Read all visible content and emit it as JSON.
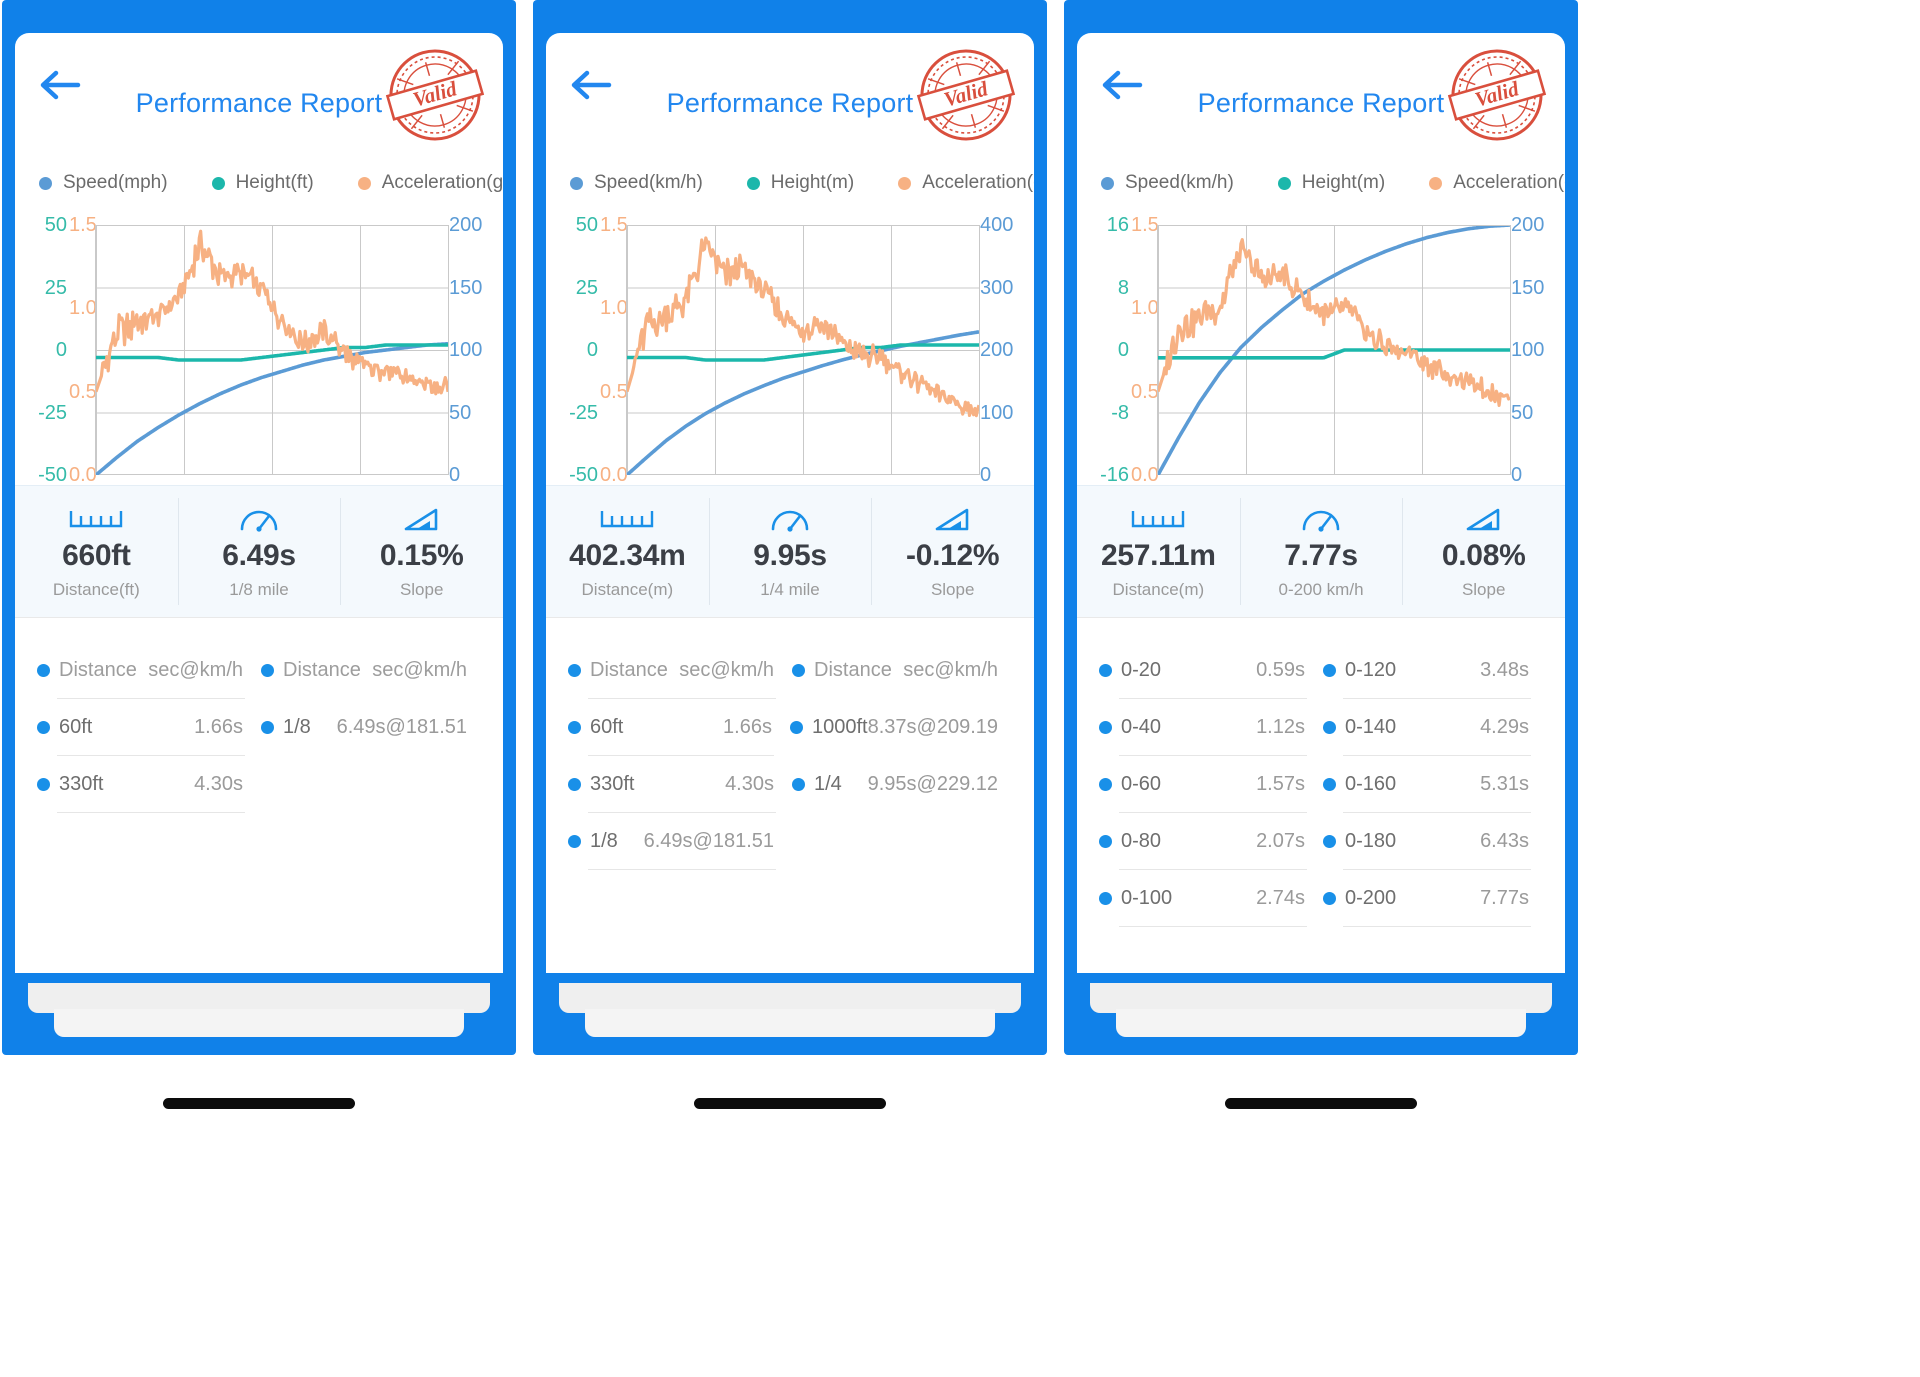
{
  "colors": {
    "brand_blue": "#1081e9",
    "title_blue": "#2287ef",
    "speed": "#5b9bd5",
    "height": "#1cb7ab",
    "acceleration": "#f7b183",
    "stamp_red": "#d94f3d",
    "dot_blue": "#1990e8"
  },
  "panels": [
    {
      "id": "imperial-eighth-mile",
      "title": "Performance Report",
      "stamp_text": "Valid",
      "back_icon": "back-arrow-icon",
      "legend": [
        {
          "label": "Speed(mph)",
          "icon": "speed-dot-icon"
        },
        {
          "label": "Height(ft)",
          "icon": "height-dot-icon"
        },
        {
          "label": "Acceleration(g)",
          "icon": "acceleration-dot-icon"
        }
      ],
      "chart_data": {
        "type": "line",
        "title": "Performance Report",
        "grid": true,
        "legend_position": "top",
        "axes": {
          "left_outer": {
            "name": "Height(ft)",
            "color": "#1cb7ab",
            "ticks": [
              "50",
              "25",
              "0",
              "-25",
              "-50"
            ],
            "range": [
              -50,
              50
            ]
          },
          "left_inner": {
            "name": "Acceleration(g)",
            "color": "#f7b183",
            "ticks": [
              "1.5",
              "1.0",
              "0.5",
              "0.0"
            ],
            "range": [
              0.0,
              1.5
            ]
          },
          "right": {
            "name": "Speed(mph)",
            "color": "#5b9bd5",
            "ticks": [
              "200",
              "150",
              "100",
              "50",
              "0"
            ],
            "range": [
              0,
              200
            ]
          }
        },
        "series": [
          {
            "name": "Speed(mph)",
            "color": "#5b9bd5",
            "axis": "right",
            "values": [
              0,
              14,
              27,
              38,
              48,
              57,
              65,
              72,
              78,
              83,
              88,
              92,
              95,
              98,
              100,
              102,
              104,
              105
            ]
          },
          {
            "name": "Height(ft)",
            "color": "#1cb7ab",
            "axis": "left_outer",
            "values": [
              -3,
              -3,
              -3,
              -3,
              -4,
              -4,
              -4,
              -4,
              -3,
              -2,
              -1,
              0,
              1,
              1,
              2,
              2,
              2,
              2
            ]
          },
          {
            "name": "Acceleration(g)",
            "color": "#f7b183",
            "axis": "left_inner",
            "values": [
              0.5,
              0.86,
              0.92,
              0.96,
              1.05,
              1.38,
              1.18,
              1.22,
              1.12,
              0.92,
              0.78,
              0.88,
              0.72,
              0.66,
              0.62,
              0.58,
              0.55,
              0.52
            ]
          }
        ]
      },
      "metrics": [
        {
          "icon": "ruler-icon",
          "value": "660ft",
          "label": "Distance(ft)"
        },
        {
          "icon": "gauge-icon",
          "value": "6.49s",
          "label": "1/8 mile"
        },
        {
          "icon": "slope-icon",
          "value": "0.15%",
          "label": "Slope"
        }
      ],
      "table": {
        "header": [
          {
            "name": "Distance",
            "value": "sec@km/h"
          },
          {
            "name": "Distance",
            "value": "sec@km/h"
          }
        ],
        "rows": [
          [
            {
              "name": "60ft",
              "value": "1.66s"
            },
            {
              "name": "1/8",
              "value": "6.49s@181.51"
            }
          ],
          [
            {
              "name": "330ft",
              "value": "4.30s"
            },
            null
          ]
        ]
      }
    },
    {
      "id": "metric-quarter-mile",
      "title": "Performance Report",
      "stamp_text": "Valid",
      "back_icon": "back-arrow-icon",
      "legend": [
        {
          "label": "Speed(km/h)",
          "icon": "speed-dot-icon"
        },
        {
          "label": "Height(m)",
          "icon": "height-dot-icon"
        },
        {
          "label": "Acceleration(g)",
          "icon": "acceleration-dot-icon"
        }
      ],
      "chart_data": {
        "type": "line",
        "title": "Performance Report",
        "grid": true,
        "legend_position": "top",
        "axes": {
          "left_outer": {
            "name": "Height(m)",
            "color": "#1cb7ab",
            "ticks": [
              "50",
              "25",
              "0",
              "-25",
              "-50"
            ],
            "range": [
              -50,
              50
            ]
          },
          "left_inner": {
            "name": "Acceleration(g)",
            "color": "#f7b183",
            "ticks": [
              "1.5",
              "1.0",
              "0.5",
              "0.0"
            ],
            "range": [
              0.0,
              1.5
            ]
          },
          "right": {
            "name": "Speed(km/h)",
            "color": "#5b9bd5",
            "ticks": [
              "400",
              "300",
              "200",
              "100",
              "0"
            ],
            "range": [
              0,
              400
            ]
          }
        },
        "series": [
          {
            "name": "Speed(km/h)",
            "color": "#5b9bd5",
            "axis": "right",
            "values": [
              0,
              28,
              55,
              78,
              98,
              115,
              130,
              143,
              155,
              165,
              175,
              184,
              192,
              199,
              206,
              212,
              218,
              224,
              229
            ]
          },
          {
            "name": "Height(m)",
            "color": "#1cb7ab",
            "axis": "left_outer",
            "values": [
              -3,
              -3,
              -3,
              -3,
              -4,
              -4,
              -4,
              -4,
              -3,
              -2,
              -1,
              0,
              1,
              1,
              2,
              2,
              2,
              2,
              2
            ]
          },
          {
            "name": "Acceleration(g)",
            "color": "#f7b183",
            "axis": "left_inner",
            "values": [
              0.5,
              0.9,
              0.96,
              1.05,
              1.38,
              1.2,
              1.24,
              1.1,
              0.95,
              0.86,
              0.92,
              0.8,
              0.72,
              0.7,
              0.62,
              0.55,
              0.48,
              0.42,
              0.38
            ]
          }
        ]
      },
      "metrics": [
        {
          "icon": "ruler-icon",
          "value": "402.34m",
          "label": "Distance(m)"
        },
        {
          "icon": "gauge-icon",
          "value": "9.95s",
          "label": "1/4 mile"
        },
        {
          "icon": "slope-icon",
          "value": "-0.12%",
          "label": "Slope"
        }
      ],
      "table": {
        "header": [
          {
            "name": "Distance",
            "value": "sec@km/h"
          },
          {
            "name": "Distance",
            "value": "sec@km/h"
          }
        ],
        "rows": [
          [
            {
              "name": "60ft",
              "value": "1.66s"
            },
            {
              "name": "1000ft",
              "value": "8.37s@209.19"
            }
          ],
          [
            {
              "name": "330ft",
              "value": "4.30s"
            },
            {
              "name": "1/4",
              "value": "9.95s@229.12"
            }
          ],
          [
            {
              "name": "1/8",
              "value": "6.49s@181.51"
            },
            null
          ]
        ]
      }
    },
    {
      "id": "metric-0-200",
      "title": "Performance Report",
      "stamp_text": "Valid",
      "back_icon": "back-arrow-icon",
      "legend": [
        {
          "label": "Speed(km/h)",
          "icon": "speed-dot-icon"
        },
        {
          "label": "Height(m)",
          "icon": "height-dot-icon"
        },
        {
          "label": "Acceleration(g)",
          "icon": "acceleration-dot-icon"
        }
      ],
      "chart_data": {
        "type": "line",
        "title": "Performance Report",
        "grid": true,
        "legend_position": "top",
        "axes": {
          "left_outer": {
            "name": "Height(m)",
            "color": "#1cb7ab",
            "ticks": [
              "16",
              "8",
              "0",
              "-8",
              "-16"
            ],
            "range": [
              -16,
              16
            ]
          },
          "left_inner": {
            "name": "Acceleration(g)",
            "color": "#f7b183",
            "ticks": [
              "1.5",
              "1.0",
              "0.5",
              "0.0"
            ],
            "range": [
              0.0,
              1.5
            ]
          },
          "right": {
            "name": "Speed(km/h)",
            "color": "#5b9bd5",
            "ticks": [
              "200",
              "150",
              "100",
              "50",
              "0"
            ],
            "range": [
              0,
              200
            ]
          }
        },
        "series": [
          {
            "name": "Speed(km/h)",
            "color": "#5b9bd5",
            "axis": "right",
            "values": [
              0,
              30,
              58,
              82,
              102,
              118,
              132,
              145,
              155,
              164,
              172,
              179,
              185,
              190,
              194,
              197,
              199,
              200
            ]
          },
          {
            "name": "Height(m)",
            "color": "#1cb7ab",
            "axis": "left_outer",
            "values": [
              -1,
              -1,
              -1,
              -1,
              -1,
              -1,
              -1,
              -1,
              -1,
              0,
              0,
              0,
              0,
              0,
              0,
              0,
              0,
              0
            ]
          },
          {
            "name": "Acceleration(g)",
            "color": "#f7b183",
            "axis": "left_inner",
            "values": [
              0.5,
              0.88,
              0.94,
              1.02,
              1.36,
              1.16,
              1.2,
              1.08,
              0.94,
              1.02,
              0.86,
              0.78,
              0.74,
              0.66,
              0.6,
              0.56,
              0.5,
              0.46
            ]
          }
        ]
      },
      "metrics": [
        {
          "icon": "ruler-icon",
          "value": "257.11m",
          "label": "Distance(m)"
        },
        {
          "icon": "gauge-icon",
          "value": "7.77s",
          "label": "0-200 km/h"
        },
        {
          "icon": "slope-icon",
          "value": "0.08%",
          "label": "Slope"
        }
      ],
      "table": {
        "header": null,
        "rows": [
          [
            {
              "name": "0-20",
              "value": "0.59s"
            },
            {
              "name": "0-120",
              "value": "3.48s"
            }
          ],
          [
            {
              "name": "0-40",
              "value": "1.12s"
            },
            {
              "name": "0-140",
              "value": "4.29s"
            }
          ],
          [
            {
              "name": "0-60",
              "value": "1.57s"
            },
            {
              "name": "0-160",
              "value": "5.31s"
            }
          ],
          [
            {
              "name": "0-80",
              "value": "2.07s"
            },
            {
              "name": "0-180",
              "value": "6.43s"
            }
          ],
          [
            {
              "name": "0-100",
              "value": "2.74s"
            },
            {
              "name": "0-200",
              "value": "7.77s"
            }
          ]
        ]
      }
    }
  ]
}
